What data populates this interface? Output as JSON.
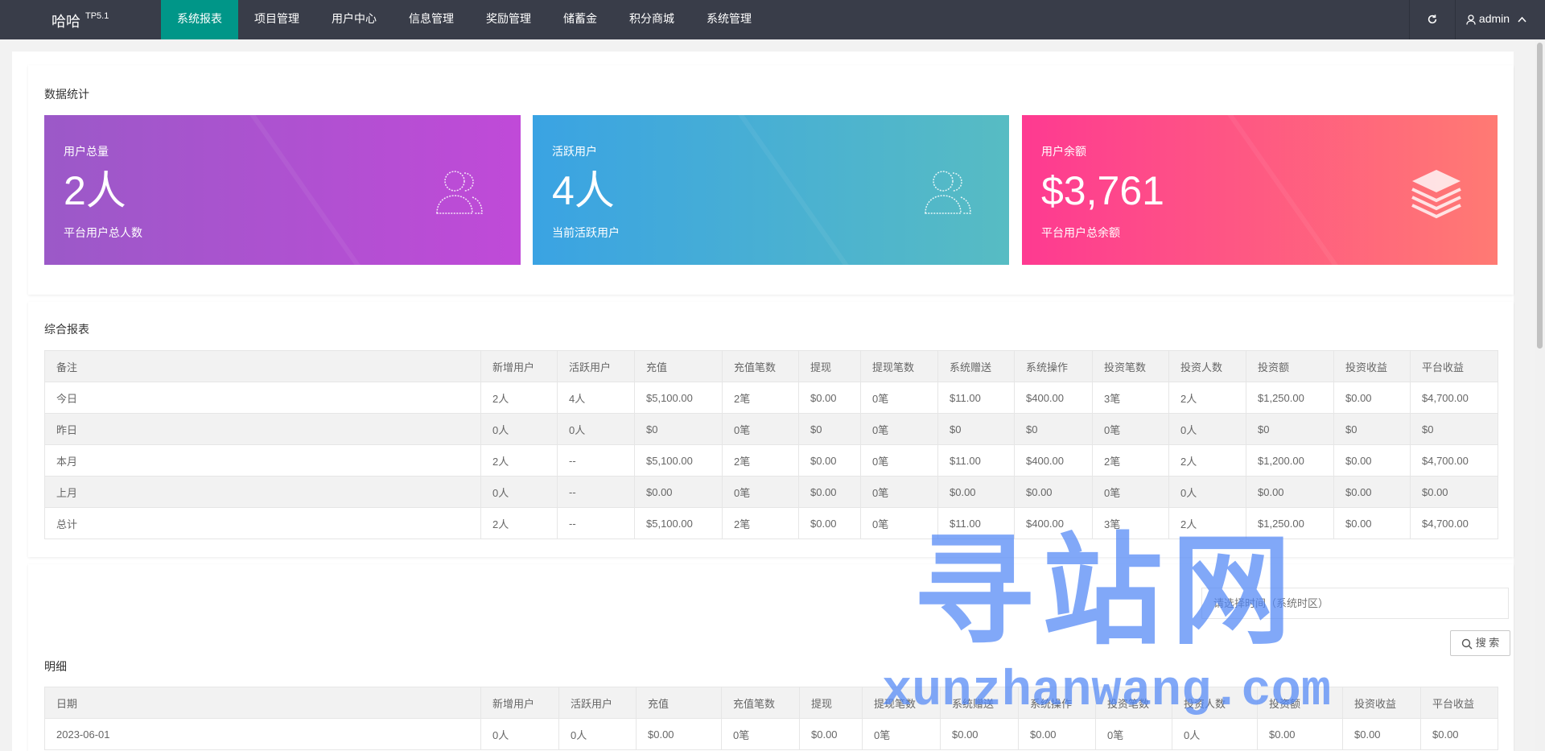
{
  "app": {
    "logo": "哈哈",
    "logo_version": "TP5.1",
    "user": "admin"
  },
  "nav": [
    {
      "label": "系统报表",
      "active": true
    },
    {
      "label": "项目管理"
    },
    {
      "label": "用户中心"
    },
    {
      "label": "信息管理"
    },
    {
      "label": "奖励管理"
    },
    {
      "label": "储蓄金"
    },
    {
      "label": "积分商城"
    },
    {
      "label": "系统管理"
    }
  ],
  "stats": {
    "title": "数据统计",
    "cards": [
      {
        "label": "用户总量",
        "value": "2人",
        "desc": "平台用户总人数",
        "icon": "users-icon"
      },
      {
        "label": "活跃用户",
        "value": "4人",
        "desc": "当前活跃用户",
        "icon": "users-icon"
      },
      {
        "label": "用户余额",
        "value": "$3,761",
        "desc": "平台用户总余额",
        "icon": "layers-icon"
      }
    ]
  },
  "report": {
    "title": "综合报表",
    "columns": [
      "备注",
      "新增用户",
      "活跃用户",
      "充值",
      "充值笔数",
      "提现",
      "提现笔数",
      "系统赠送",
      "系统操作",
      "投资笔数",
      "投资人数",
      "投资额",
      "投资收益",
      "平台收益"
    ],
    "rows": [
      [
        "今日",
        "2人",
        "4人",
        "$5,100.00",
        "2笔",
        "$0.00",
        "0笔",
        "$11.00",
        "$400.00",
        "3笔",
        "2人",
        "$1,250.00",
        "$0.00",
        "$4,700.00"
      ],
      [
        "昨日",
        "0人",
        "0人",
        "$0",
        "0笔",
        "$0",
        "0笔",
        "$0",
        "$0",
        "0笔",
        "0人",
        "$0",
        "$0",
        "$0"
      ],
      [
        "本月",
        "2人",
        "--",
        "$5,100.00",
        "2笔",
        "$0.00",
        "0笔",
        "$11.00",
        "$400.00",
        "2笔",
        "2人",
        "$1,200.00",
        "$0.00",
        "$4,700.00"
      ],
      [
        "上月",
        "0人",
        "--",
        "$0.00",
        "0笔",
        "$0.00",
        "0笔",
        "$0.00",
        "$0.00",
        "0笔",
        "0人",
        "$0.00",
        "$0.00",
        "$0.00"
      ],
      [
        "总计",
        "2人",
        "--",
        "$5,100.00",
        "2笔",
        "$0.00",
        "0笔",
        "$11.00",
        "$400.00",
        "3笔",
        "2人",
        "$1,250.00",
        "$0.00",
        "$4,700.00"
      ]
    ]
  },
  "detail": {
    "title": "明细",
    "date_placeholder": "请选择时间（系统时区）",
    "search_label": "搜 索",
    "columns": [
      "日期",
      "新增用户",
      "活跃用户",
      "充值",
      "充值笔数",
      "提现",
      "提现笔数",
      "系统赠送",
      "系统操作",
      "投资笔数",
      "投资人数",
      "投资额",
      "投资收益",
      "平台收益"
    ],
    "rows": [
      [
        "2023-06-01",
        "0人",
        "0人",
        "$0.00",
        "0笔",
        "$0.00",
        "0笔",
        "$0.00",
        "$0.00",
        "0笔",
        "0人",
        "$0.00",
        "$0.00",
        "$0.00"
      ]
    ]
  },
  "watermark": {
    "title": "寻站网",
    "url": "xunzhanwang.com"
  }
}
